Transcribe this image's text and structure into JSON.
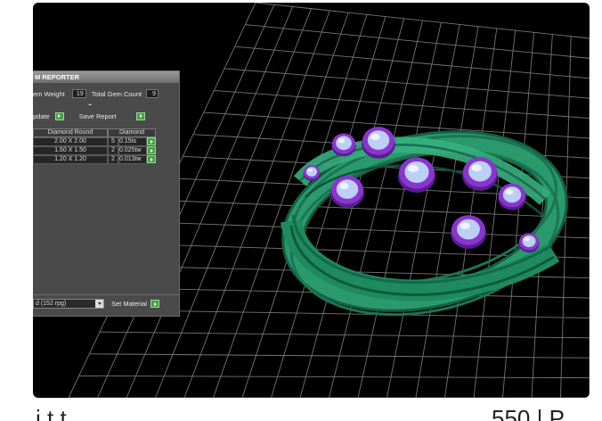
{
  "panel": {
    "title": "M REPORTER",
    "gem_weight_label": "em Weight",
    "gem_weight_value": "19",
    "total_count_label": "Total Gem Count",
    "total_count_value": "9",
    "update_label": "pdate",
    "save_report_label": "Save Report",
    "columns": [
      "Diamond Round",
      "Diamond"
    ],
    "rows": [
      {
        "size": "2.00 X 2.00",
        "qty": "5",
        "weight": "0.15ts"
      },
      {
        "size": "1.50 X 1.50",
        "qty": "2",
        "weight": "0.025tw"
      },
      {
        "size": "1.20 X 1.20",
        "qty": "2",
        "weight": "0.013tw"
      }
    ],
    "material_select_value": "d   (152 rpg)",
    "set_material_label": "Set Material"
  },
  "caption": {
    "left_text": "i    t    t",
    "right_text": "550 | P"
  },
  "colors": {
    "ring": "#1f7f5a",
    "gem_setting": "#7a2bb8",
    "gem_stone": "#b9c8f2",
    "grid": "#8a8a8a"
  }
}
